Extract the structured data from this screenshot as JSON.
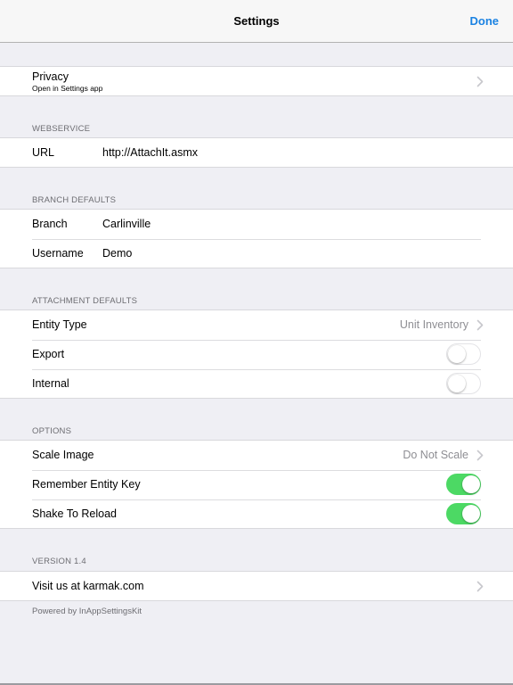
{
  "navbar": {
    "title": "Settings",
    "done_label": "Done"
  },
  "privacy": {
    "label": "Privacy",
    "subtitle": "Open in Settings app"
  },
  "webservice": {
    "header": "WEBSERVICE",
    "url_label": "URL",
    "url_value": "http://AttachIt.asmx"
  },
  "branch_defaults": {
    "header": "BRANCH DEFAULTS",
    "branch_label": "Branch",
    "branch_value": "Carlinville",
    "username_label": "Username",
    "username_value": "Demo"
  },
  "attachment_defaults": {
    "header": "ATTACHMENT DEFAULTS",
    "entity_type_label": "Entity Type",
    "entity_type_value": "Unit Inventory",
    "export_label": "Export",
    "export_on": false,
    "internal_label": "Internal",
    "internal_on": false
  },
  "options": {
    "header": "OPTIONS",
    "scale_image_label": "Scale Image",
    "scale_image_value": "Do Not Scale",
    "remember_label": "Remember Entity Key",
    "remember_on": true,
    "shake_label": "Shake To Reload",
    "shake_on": true
  },
  "version": {
    "header": "VERSION 1.4",
    "visit_label": "Visit us at karmak.com",
    "footer": "Powered by InAppSettingsKit"
  },
  "colors": {
    "accent": "#1a82e2",
    "toggle_on": "#4cd964",
    "background": "#efeff4"
  }
}
